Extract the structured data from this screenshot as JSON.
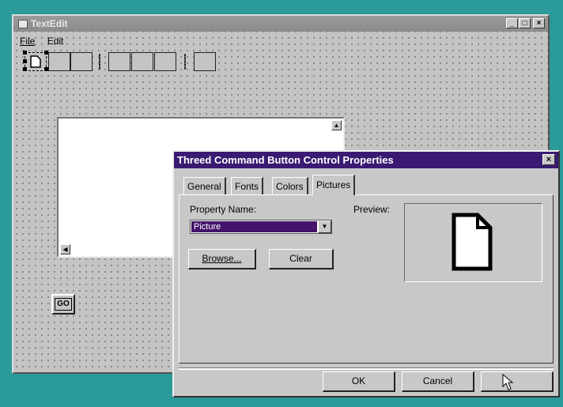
{
  "form": {
    "title": "TextEdit",
    "menu": [
      "File",
      "Edit"
    ],
    "window_buttons": [
      "_",
      "□",
      "×"
    ],
    "go_label": "GO"
  },
  "dialog": {
    "title": "Threed Command Button Control Properties",
    "close": "×",
    "tabs": [
      {
        "label": "General",
        "active": false
      },
      {
        "label": "Fonts",
        "active": false
      },
      {
        "label": "Colors",
        "active": false
      },
      {
        "label": "Pictures",
        "active": true
      }
    ],
    "property_name_label": "Property Name:",
    "property_value": "Picture",
    "preview_label": "Preview:",
    "browse_label": "Browse...",
    "clear_label": "Clear",
    "ok_label": "OK",
    "cancel_label": "Cancel",
    "apply_label": ""
  },
  "icons": [
    "document-icon",
    "cursor-icon",
    "app-icon"
  ],
  "colors": {
    "desktop": "#2a9a9a",
    "dialog_title": "#3a1a72",
    "selection": "#44156a"
  }
}
